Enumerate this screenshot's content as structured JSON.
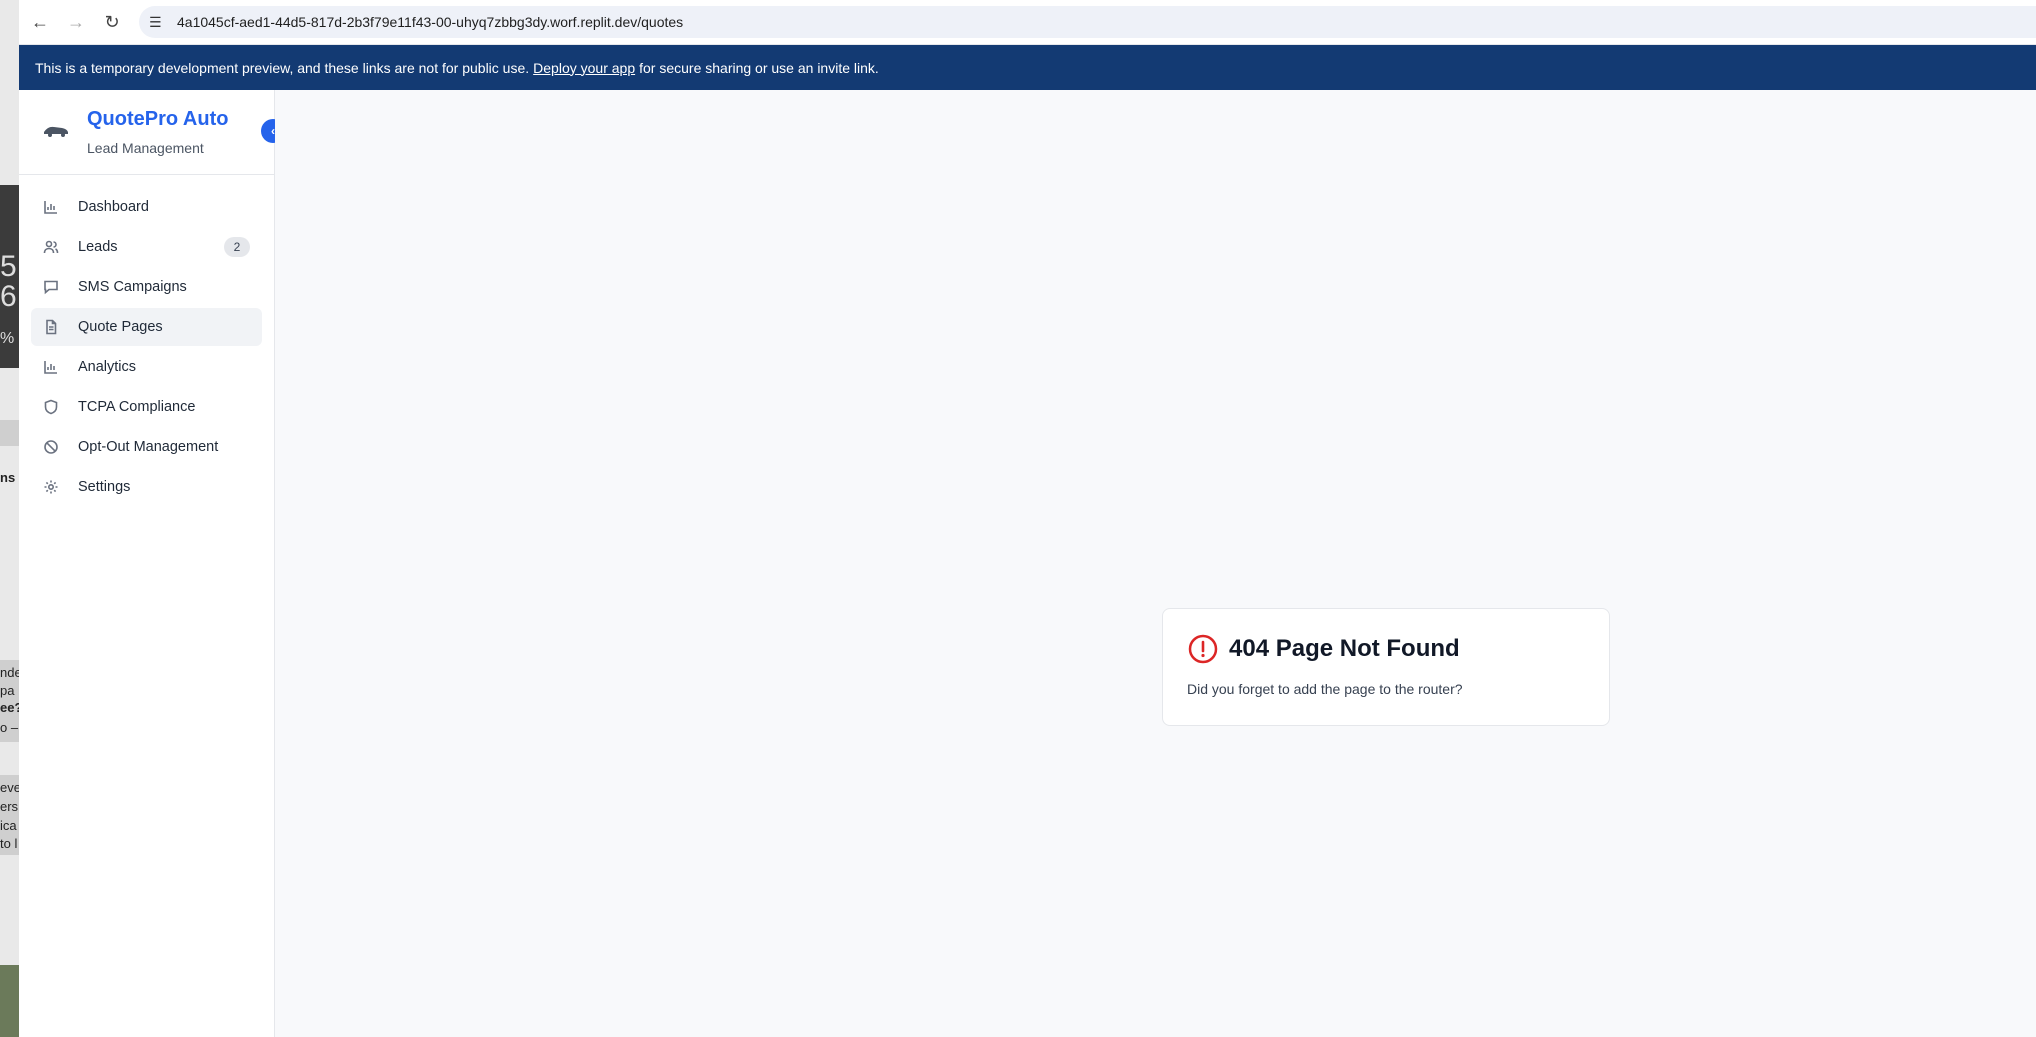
{
  "browser": {
    "url": "4a1045cf-aed1-44d5-817d-2b3f79e11f43-00-uhyq7zbbg3dy.worf.replit.dev/quotes"
  },
  "banner": {
    "text_before": "This is a temporary development preview, and these links are not for public use.",
    "link": "Deploy your app",
    "text_after": "for secure sharing or use an invite link."
  },
  "sidebar": {
    "brand_title": "QuotePro Auto",
    "brand_subtitle": "Lead Management",
    "items": [
      {
        "label": "Dashboard",
        "icon": "bar-chart-icon"
      },
      {
        "label": "Leads",
        "icon": "users-icon",
        "badge": "2"
      },
      {
        "label": "SMS Campaigns",
        "icon": "message-icon"
      },
      {
        "label": "Quote Pages",
        "icon": "file-icon",
        "active": true
      },
      {
        "label": "Analytics",
        "icon": "bar-chart-icon"
      },
      {
        "label": "TCPA Compliance",
        "icon": "shield-icon"
      },
      {
        "label": "Opt-Out Management",
        "icon": "ban-icon"
      },
      {
        "label": "Settings",
        "icon": "gear-icon"
      }
    ]
  },
  "error_card": {
    "title": "404 Page Not Found",
    "message": "Did you forget to add the page to the router?",
    "icon_color": "#dc2626"
  },
  "colors": {
    "accent": "#2563eb",
    "banner_bg": "#133a73"
  }
}
